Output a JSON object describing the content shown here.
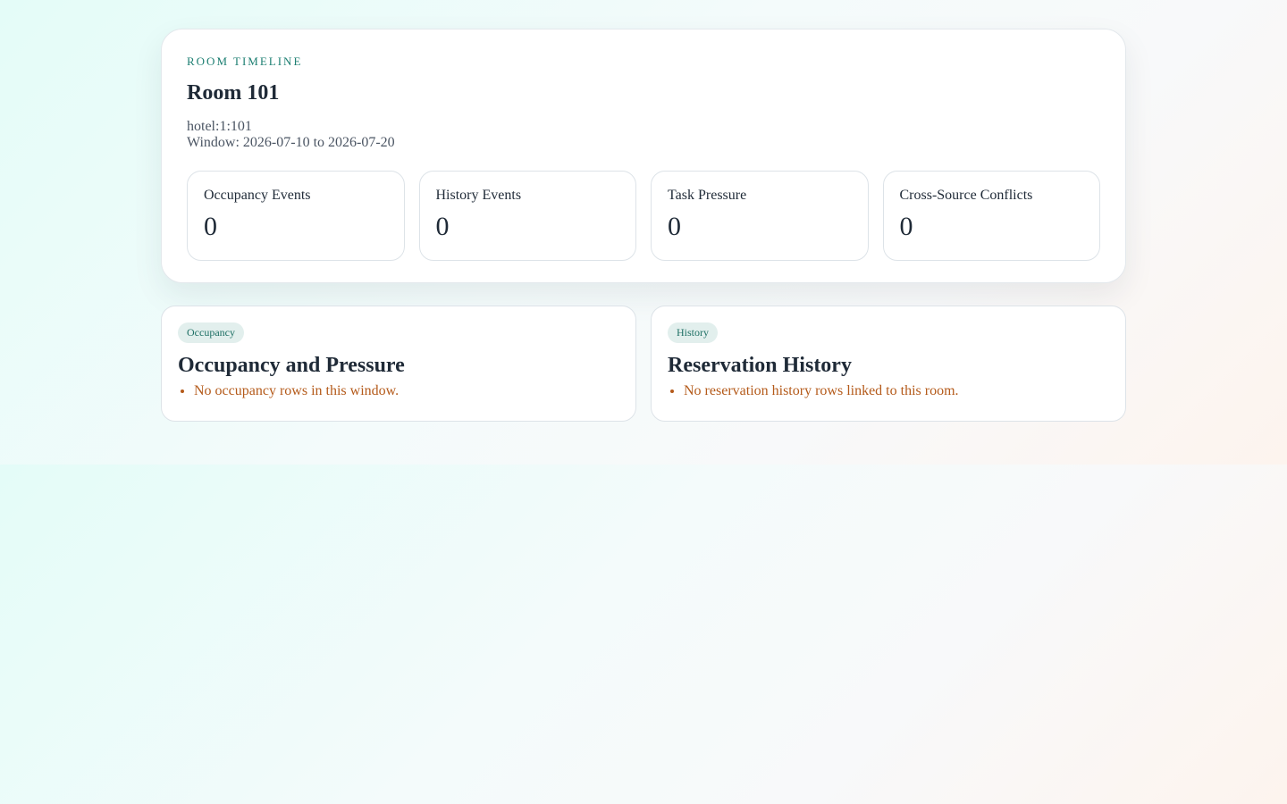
{
  "hero": {
    "eyebrow": "ROOM TIMELINE",
    "title": "Room 101",
    "room_id": "hotel:1:101",
    "window": "Window: 2026-07-10 to 2026-07-20"
  },
  "stats": [
    {
      "label": "Occupancy Events",
      "value": "0"
    },
    {
      "label": "History Events",
      "value": "0"
    },
    {
      "label": "Task Pressure",
      "value": "0"
    },
    {
      "label": "Cross-Source Conflicts",
      "value": "0"
    }
  ],
  "panels": [
    {
      "chip": "Occupancy",
      "title": "Occupancy and Pressure",
      "items": [
        "No occupancy rows in this window."
      ]
    },
    {
      "chip": "History",
      "title": "Reservation History",
      "items": [
        "No reservation history rows linked to this room."
      ]
    }
  ],
  "colors": {
    "accent": "#1d7f72",
    "warning_text": "#b45a1a",
    "chip_bg": "#e2efed"
  }
}
